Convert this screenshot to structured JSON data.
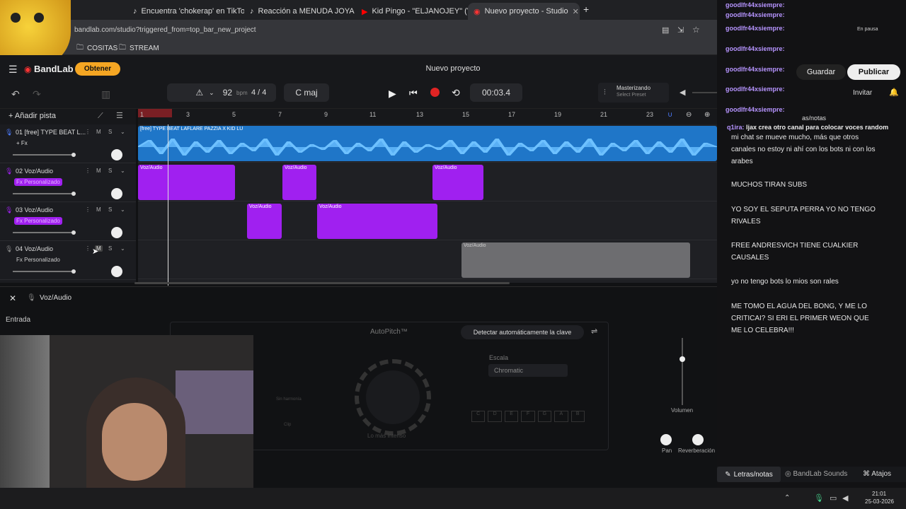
{
  "browser": {
    "tabs": [
      {
        "title": "Encuentra 'chokerap' en TikTok"
      },
      {
        "title": "Reacción a MENUDA JOYA DYS"
      },
      {
        "title": "Kid Pingo - \"ELJANOJEY\" (VÍDE"
      },
      {
        "title": "Nuevo proyecto - Studio"
      }
    ],
    "url": "bandlab.com/studio?triggered_from=top_bar_new_project",
    "bookmarks": [
      "COSITAS",
      "STREAM"
    ]
  },
  "bandlab": {
    "logo": "BandLab",
    "obtener": "Obtener",
    "project_title": "Nuevo proyecto",
    "guardar": "Guardar",
    "publicar": "Publicar",
    "invitar": "Invitar",
    "bpm": "92",
    "bpm_unit": "bpm",
    "time_sig": "4 / 4",
    "key": "C maj",
    "time": "00:03.4",
    "mastering": "Masterizando",
    "preset": "Select Preset",
    "add_track": "Añadir pista",
    "ruler": [
      "1",
      "3",
      "5",
      "7",
      "9",
      "11",
      "13",
      "15",
      "17",
      "19",
      "21",
      "23"
    ],
    "tracks": [
      {
        "num": "01",
        "name": "[free] TYPE BEAT L...",
        "fx": "+ Fx",
        "clip_label": "[free] TYPE BEAT LAFLARE PAZZIA X KID LU"
      },
      {
        "num": "02",
        "name": "Voz/Audio",
        "fx": "Fx Personalizado",
        "clip_label": "Voz/Audio"
      },
      {
        "num": "03",
        "name": "Voz/Audio",
        "fx": "Fx Personalizado",
        "clip_label": "Voz/Audio"
      },
      {
        "num": "04",
        "name": "Voz/Audio",
        "fx": "Fx Personalizado",
        "clip_label": "Voz/Audio"
      }
    ],
    "m": "M",
    "s": "S",
    "panel": {
      "title": "Voz/Audio",
      "entrada": "Entrada",
      "autopitch": "AutoPitch™",
      "detect": "Detectar automáticamente la clave",
      "escala": "Escala",
      "scale_value": "Chromatic",
      "intensity": "Lo más intenso",
      "notes": [
        "C",
        "D",
        "E",
        "F",
        "G",
        "A",
        "B"
      ],
      "volumen": "Volumen",
      "pan": "Pan",
      "reverb": "Reverberación",
      "harmony": "Sin harmonía",
      "clip": "Clip"
    }
  },
  "chat": {
    "user": "goodlfr44xsiempre:",
    "top_user": "q1ira:",
    "top_msg": "ljax crea otro canal para colocar voces random",
    "messages": [
      "mi chat se mueve mucho, más que otros canales no estoy ni ahí con los bots ni con los arabes",
      "MUCHOS TIRAN SUBS",
      "YO SOY EL SEPUTA PERRA YO NO TENGO RIVALES",
      "FREE ANDRESVICH TIENE CUALKIER CAUSALES",
      "yo no tengo bots lo mios son rales",
      "ME TOMO EL AGUA DEL BONG, Y ME LO CRITICAI? SI ERI EL PRIMER WEON QUE ME LO CELEBRA!!!"
    ],
    "overlay_label": "as/notas",
    "en_pausa": "En pausa"
  },
  "status": {
    "letras": "Letras/notas",
    "sounds": "BandLab Sounds",
    "atajos": "Atajos"
  },
  "taskbar": {
    "time": "21:01",
    "date": "25-03-2026"
  },
  "colors": {
    "beat": "#3a9ff5",
    "vocal": "#a020f0",
    "vocal_inactive": "#8a8a8a",
    "accent": "#f5a623",
    "record": "#e02424"
  }
}
